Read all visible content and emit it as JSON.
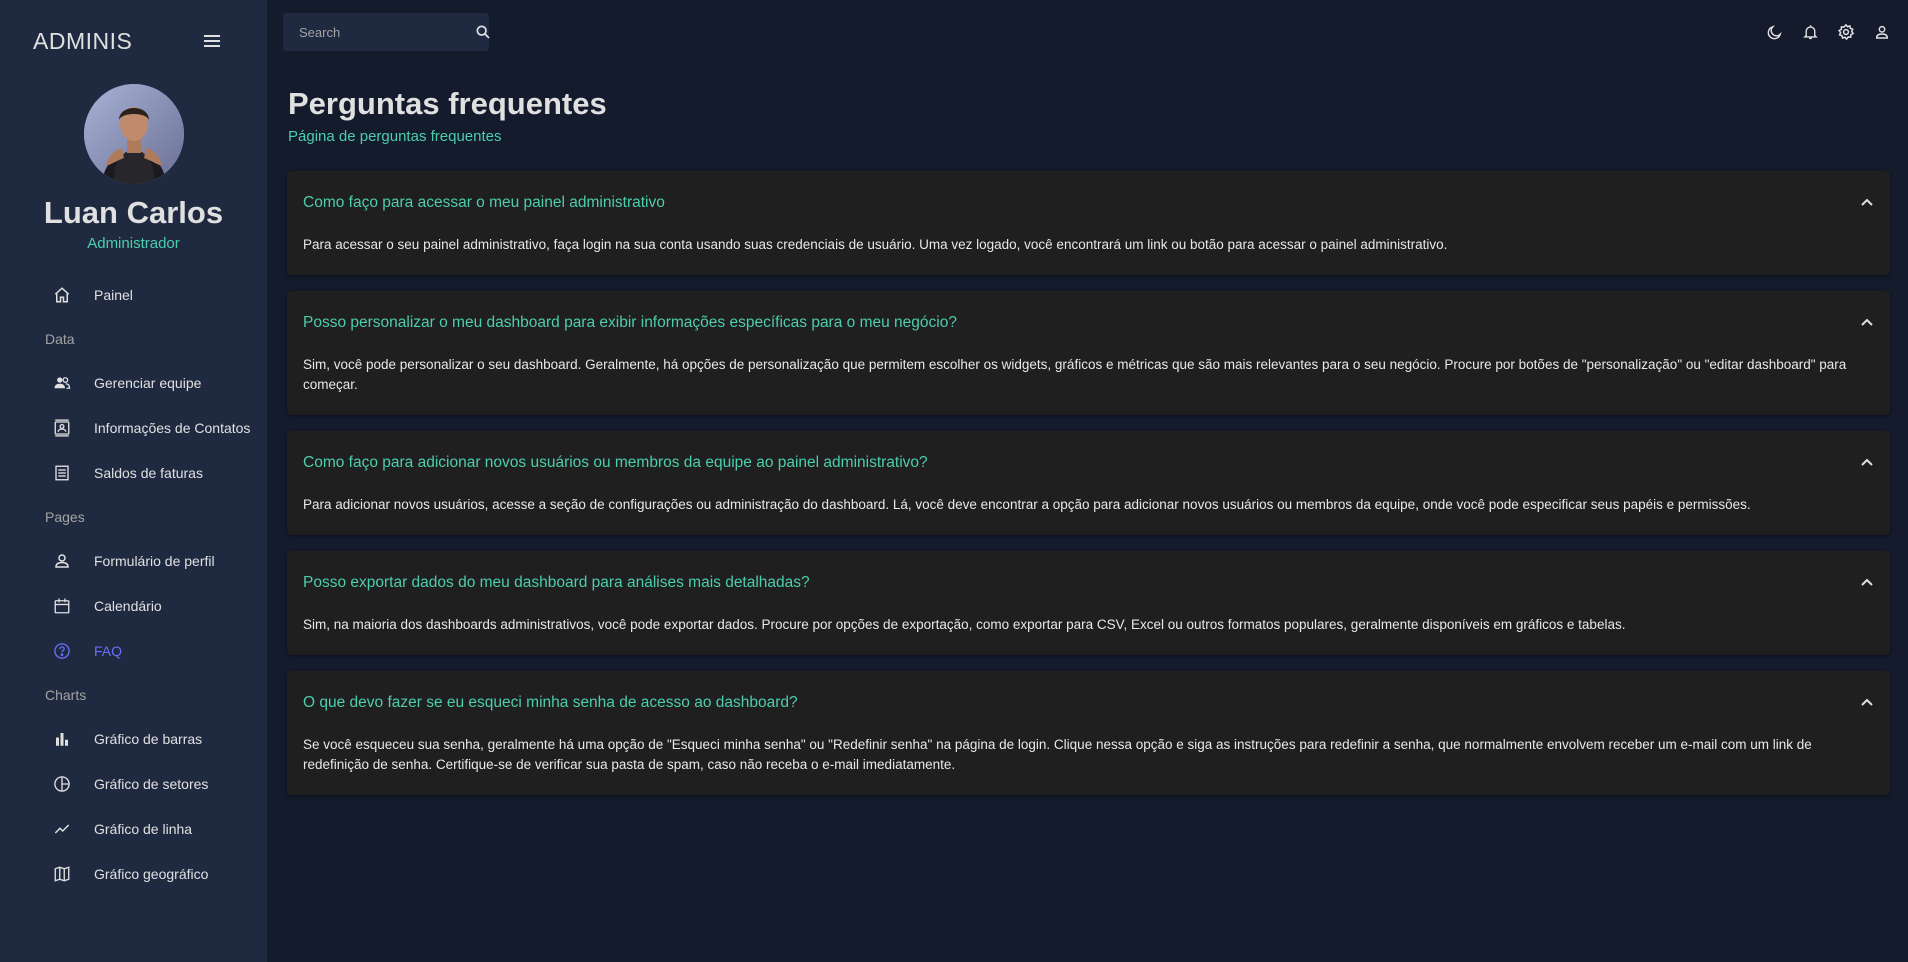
{
  "brand": "ADMINIS",
  "user": {
    "name": "Luan Carlos",
    "role": "Administrador"
  },
  "sidebar": {
    "top_item": {
      "label": "Painel",
      "icon": "home-icon"
    },
    "sections": [
      {
        "title": "Data",
        "items": [
          {
            "label": "Gerenciar equipe",
            "icon": "people-icon"
          },
          {
            "label": "Informações de Contatos",
            "icon": "contacts-icon"
          },
          {
            "label": "Saldos de faturas",
            "icon": "receipt-icon"
          }
        ]
      },
      {
        "title": "Pages",
        "items": [
          {
            "label": "Formulário de perfil",
            "icon": "person-icon"
          },
          {
            "label": "Calendário",
            "icon": "calendar-icon"
          },
          {
            "label": "FAQ",
            "icon": "help-icon",
            "active": true
          }
        ]
      },
      {
        "title": "Charts",
        "items": [
          {
            "label": "Gráfico de barras",
            "icon": "bar-chart-icon"
          },
          {
            "label": "Gráfico de setores",
            "icon": "pie-chart-icon"
          },
          {
            "label": "Gráfico de linha",
            "icon": "line-chart-icon"
          },
          {
            "label": "Gráfico geográfico",
            "icon": "map-icon"
          }
        ]
      }
    ]
  },
  "search": {
    "placeholder": "Search"
  },
  "page": {
    "title": "Perguntas frequentes",
    "subtitle": "Página de perguntas frequentes"
  },
  "faqs": [
    {
      "question": "Como faço para acessar o meu painel administrativo",
      "answer": "Para acessar o seu painel administrativo, faça login na sua conta usando suas credenciais de usuário. Uma vez logado, você encontrará um link ou botão para acessar o painel administrativo."
    },
    {
      "question": "Posso personalizar o meu dashboard para exibir informações específicas para o meu negócio?",
      "answer": "Sim, você pode personalizar o seu dashboard. Geralmente, há opções de personalização que permitem escolher os widgets, gráficos e métricas que são mais relevantes para o seu negócio. Procure por botões de \"personalização\" ou \"editar dashboard\" para começar."
    },
    {
      "question": "Como faço para adicionar novos usuários ou membros da equipe ao painel administrativo?",
      "answer": "Para adicionar novos usuários, acesse a seção de configurações ou administração do dashboard. Lá, você deve encontrar a opção para adicionar novos usuários ou membros da equipe, onde você pode especificar seus papéis e permissões."
    },
    {
      "question": "Posso exportar dados do meu dashboard para análises mais detalhadas?",
      "answer": "Sim, na maioria dos dashboards administrativos, você pode exportar dados. Procure por opções de exportação, como exportar para CSV, Excel ou outros formatos populares, geralmente disponíveis em gráficos e tabelas."
    },
    {
      "question": "O que devo fazer se eu esqueci minha senha de acesso ao dashboard?",
      "answer": "Se você esqueceu sua senha, geralmente há uma opção de \"Esqueci minha senha\" ou \"Redefinir senha\" na página de login. Clique nessa opção e siga as instruções para redefinir a senha, que normalmente envolvem receber um e-mail com um link de redefinição de senha. Certifique-se de verificar sua pasta de spam, caso não receba o e-mail imediatamente."
    }
  ],
  "colors": {
    "accent": "#4cceac",
    "active": "#6870fa",
    "sidebar_bg": "#1f2a40",
    "page_bg": "#141b2d"
  }
}
